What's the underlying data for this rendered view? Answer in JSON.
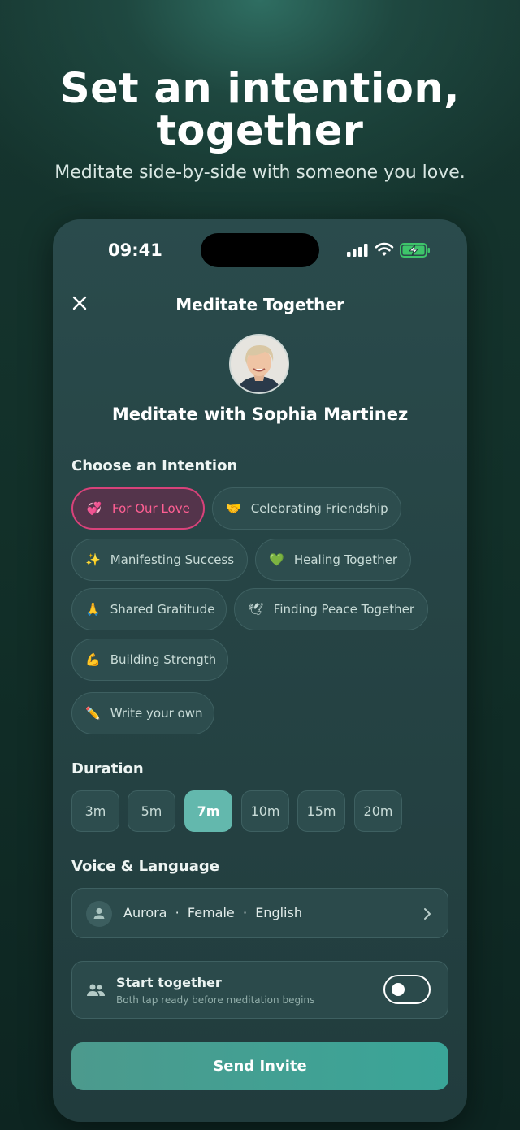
{
  "hero": {
    "title_line1": "Set an intention,",
    "title_line2": "together",
    "subtitle": "Meditate side-by-side with someone you love."
  },
  "status_bar": {
    "time": "09:41"
  },
  "nav": {
    "title": "Meditate Together",
    "close_icon": "close-icon"
  },
  "partner": {
    "heading": "Meditate with Sophia Martinez"
  },
  "intention": {
    "label": "Choose an Intention",
    "chips": [
      {
        "emoji": "💞",
        "label": "For Our Love",
        "selected": true
      },
      {
        "emoji": "🤝",
        "label": "Celebrating Friendship"
      },
      {
        "emoji": "✨",
        "label": "Manifesting Success"
      },
      {
        "emoji": "💚",
        "label": "Healing Together"
      },
      {
        "emoji": "🙏",
        "label": "Shared Gratitude"
      },
      {
        "emoji": "🕊",
        "label": "Finding Peace Together"
      },
      {
        "emoji": "💪",
        "label": "Building Strength"
      },
      {
        "emoji": "✏️",
        "label": "Write your own"
      }
    ]
  },
  "duration": {
    "label": "Duration",
    "options": [
      "3m",
      "5m",
      "7m",
      "10m",
      "15m",
      "20m"
    ],
    "selected": "7m"
  },
  "voice": {
    "label": "Voice & Language",
    "value": "Aurora  ·  Female  ·  English"
  },
  "start_together": {
    "title": "Start together",
    "subtitle": "Both tap ready before meditation begins",
    "enabled": false
  },
  "send_button": {
    "label": "Send Invite"
  },
  "colors": {
    "accent": "#63b8ad",
    "selected_chip": "#d8427a",
    "button": "#3aa598"
  }
}
